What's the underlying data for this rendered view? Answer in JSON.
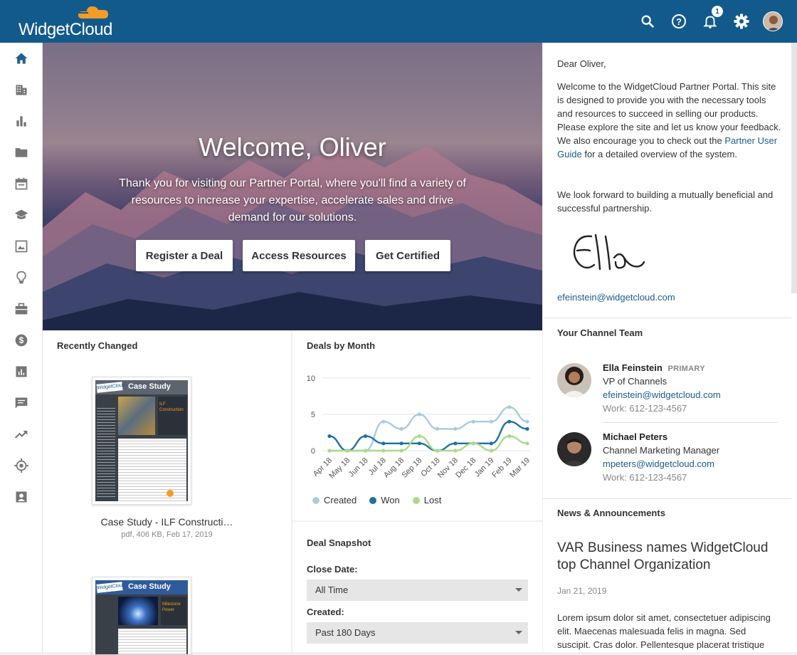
{
  "brand": {
    "name": "WidgetCloud",
    "primary": "#135a8c",
    "accent": "#f39c27"
  },
  "topbar": {
    "icons": [
      "search-icon",
      "help-icon",
      "notifications-icon",
      "settings-icon",
      "user-avatar"
    ],
    "notification_count": "1"
  },
  "sidebar": {
    "items": [
      "home-icon",
      "accounts-icon",
      "reports-icon",
      "folder-icon",
      "calendar-icon",
      "training-icon",
      "image-icon",
      "ideas-icon",
      "briefcase-icon",
      "dollar-icon",
      "analytics-icon",
      "chat-icon",
      "trends-icon",
      "target-icon",
      "contacts-icon"
    ]
  },
  "hero": {
    "title": "Welcome, Oliver",
    "subtitle": "Thank you for visiting our Partner Portal, where you'll find a variety of resources to increase your expertise, accelerate sales and drive demand for our solutions.",
    "buttons": [
      "Register a Deal",
      "Access Resources",
      "Get Certified"
    ]
  },
  "recent": {
    "title": "Recently Changed",
    "docs": [
      {
        "badge": "Case Study",
        "subtitle": "ILF Construction",
        "name": "Case Study - ILF Constructi…",
        "meta": "pdf, 406 KB, Feb 17, 2019"
      },
      {
        "badge": "Case Study",
        "subtitle": "Milestone Power",
        "name": "",
        "meta": ""
      }
    ]
  },
  "deals": {
    "title": "Deals by Month",
    "legend": [
      "Created",
      "Won",
      "Lost"
    ]
  },
  "chart_data": {
    "type": "line",
    "title": "Deals by Month",
    "xlabel": "",
    "ylabel": "",
    "categories": [
      "Apr 18",
      "May 18",
      "Jun 18",
      "Jul 18",
      "Aug 18",
      "Sep 18",
      "Oct 18",
      "Nov 18",
      "Dec 18",
      "Jan 19",
      "Feb 19",
      "Mar 19"
    ],
    "ylim": [
      0,
      10
    ],
    "yticks": [
      0,
      5,
      10
    ],
    "grid": true,
    "legend": "bottom",
    "series": [
      {
        "name": "Created",
        "color": "#a9cbe0",
        "values": [
          0,
          0,
          0,
          4,
          3,
          5,
          3,
          3,
          4,
          4,
          6,
          4
        ]
      },
      {
        "name": "Won",
        "color": "#1f6fa5",
        "values": [
          2,
          0,
          2,
          1,
          1,
          1,
          0,
          1,
          1,
          1,
          4,
          3
        ]
      },
      {
        "name": "Lost",
        "color": "#a8dc8a",
        "values": [
          0,
          0,
          0,
          0,
          0,
          2,
          0,
          0,
          1,
          0,
          2,
          1
        ]
      }
    ]
  },
  "snapshot": {
    "title": "Deal Snapshot",
    "close_label": "Close Date:",
    "close_value": "All Time",
    "created_label": "Created:",
    "created_value": "Past 180 Days"
  },
  "letter": {
    "greeting": "Dear Oliver,",
    "para1_a": "Welcome to the WidgetCloud Partner Portal. This site is designed to provide you with the necessary tools and resources to succeed in selling our products. Please explore the site and let us know your feedback. We also encourage you to check out the",
    "para1_link": "Partner User Guide",
    "para1_b": "for a detailed overview of the system.",
    "para2": "We look forward to building a mutually beneficial and successful partnership.",
    "email": "efeinstein@widgetcloud.com"
  },
  "team": {
    "title": "Your Channel Team",
    "members": [
      {
        "name": "Ella Feinstein",
        "tag": "PRIMARY",
        "role": "VP of Channels",
        "email": "efeinstein@widgetcloud.com",
        "phone": "Work: 612-123-4567"
      },
      {
        "name": "Michael Peters",
        "tag": "",
        "role": "Channel Marketing Manager",
        "email": "mpeters@widgetcloud.com",
        "phone": "Work: 612-123-4567"
      }
    ]
  },
  "news": {
    "title": "News & Announcements",
    "headline": "VAR Business names WidgetCloud top Channel Organization",
    "date": "Jan 21, 2019",
    "body": "Lorem ipsum dolor sit amet, consectetuer adipiscing elit. Maecenas malesuada felis in magna. Sed suscipit. Cras dolor. Pellentesque placerat tristique"
  }
}
